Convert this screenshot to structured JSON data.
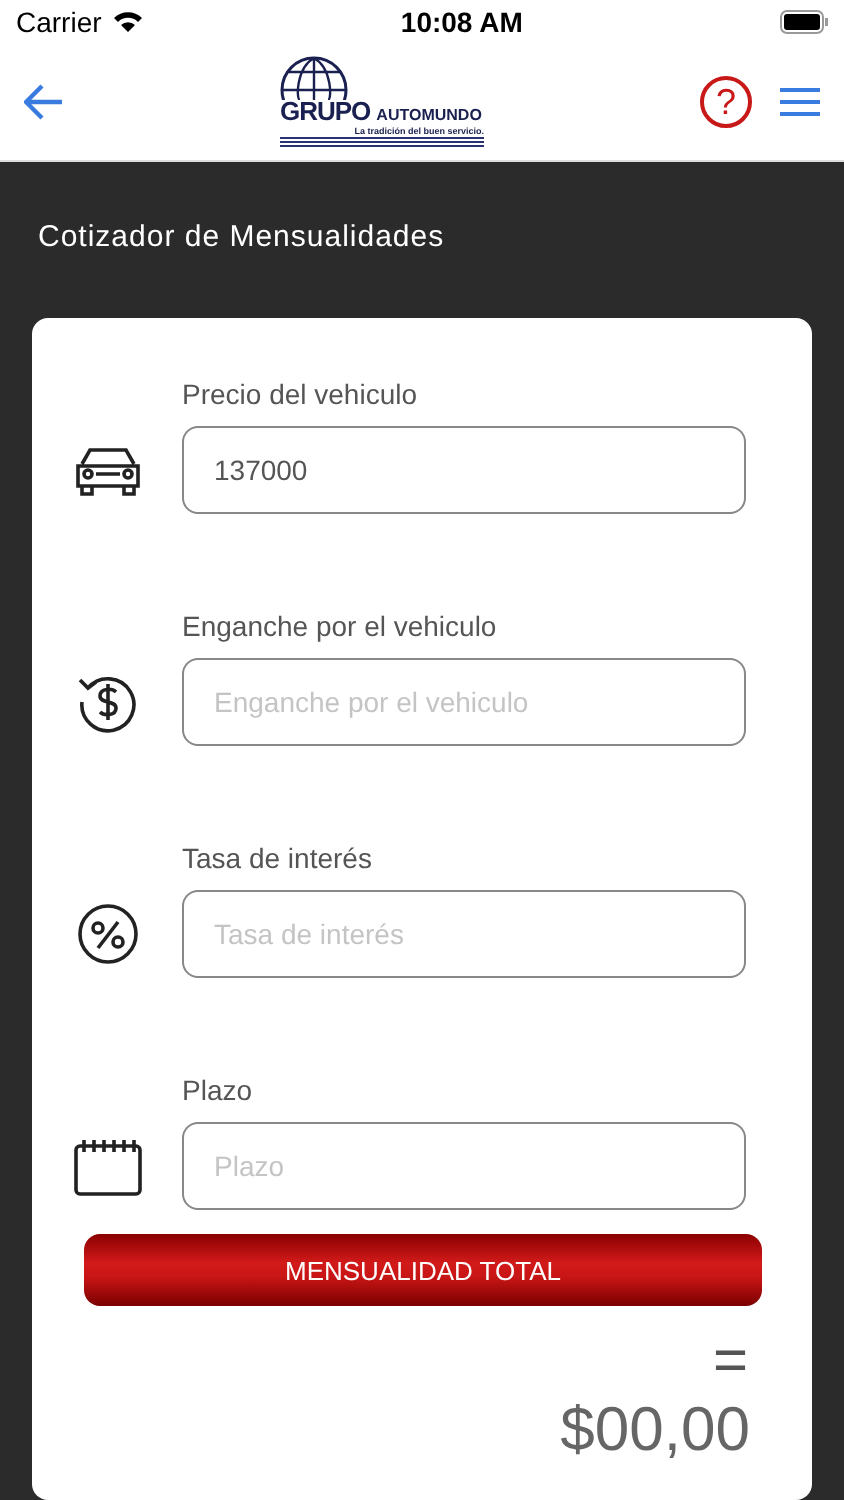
{
  "status_bar": {
    "carrier": "Carrier",
    "time": "10:08 AM"
  },
  "nav": {
    "logo": {
      "word1": "GRUPO",
      "word2": "AUTOMUNDO",
      "tagline": "La tradición del buen servicio."
    },
    "help": "?"
  },
  "title": "Cotizador de Mensualidades",
  "fields": [
    {
      "kind": "car",
      "label": "Precio del vehiculo",
      "value": "137000"
    },
    {
      "kind": "money",
      "label": "Enganche por el vehiculo",
      "placeholder": "Enganche por el vehiculo"
    },
    {
      "kind": "percent",
      "label": "Tasa de interés",
      "placeholder": "Tasa de interés"
    },
    {
      "kind": "calendar",
      "label": "Plazo",
      "placeholder": "Plazo"
    }
  ],
  "button": "MENSUALIDAD TOTAL",
  "equals": "=",
  "result": "$00,00"
}
